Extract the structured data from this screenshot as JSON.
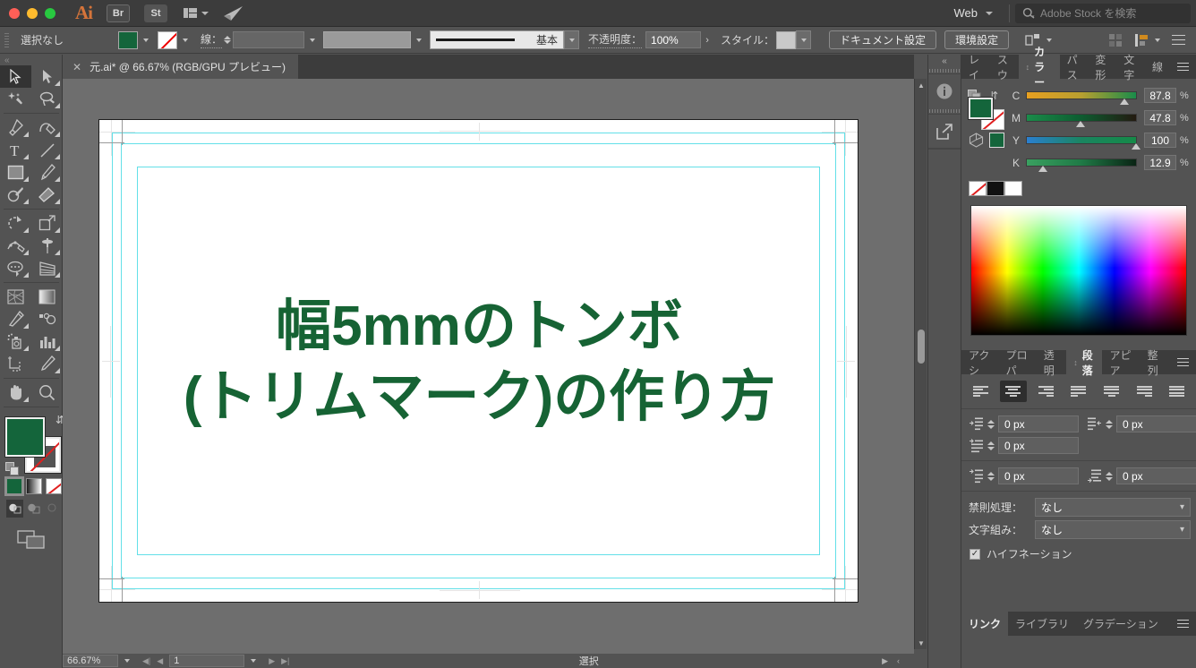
{
  "titlebar": {
    "app_icon": "ai-logo",
    "bridge_label": "Br",
    "stock_label": "St",
    "workspace_label": "Web",
    "search_placeholder": "Adobe Stock を検索",
    "search_icon": "search-icon",
    "share_icon": "share-paper-plane-icon",
    "arrange_icon": "arrange-documents-icon"
  },
  "controlbar": {
    "selection_status": "選択なし",
    "fill_swatch_color": "#14653b",
    "stroke_swatch": "none",
    "stroke_label": "線：",
    "stroke_weight": "",
    "stroke_variable_width": "",
    "stroke_profile_label": "基本",
    "opacity_label": "不透明度：",
    "opacity_value": "100%",
    "style_label": "スタイル：",
    "document_setup_button": "ドキュメント設定",
    "preferences_button": "環境設定",
    "align_icon": "align-to-selection-icon",
    "transform_icon": "transform-grid-icon",
    "distribute_icon": "distribute-icon",
    "panel_menu_icon": "panel-menu-icon"
  },
  "tabbar": {
    "close_icon": "close-icon",
    "document_title": "元.ai* @ 66.67% (RGB/GPU プレビュー)"
  },
  "toolbar": {
    "tools": [
      {
        "name": "selection-tool",
        "glyph": "selection",
        "selected": true
      },
      {
        "name": "direct-selection-tool",
        "glyph": "direct-selection",
        "selected": false
      },
      {
        "name": "magic-wand-tool",
        "glyph": "magic-wand",
        "selected": false
      },
      {
        "name": "lasso-tool",
        "glyph": "lasso",
        "selected": false
      },
      {
        "name": "pen-tool",
        "glyph": "pen",
        "selected": false
      },
      {
        "name": "curvature-tool",
        "glyph": "curvature",
        "selected": false
      },
      {
        "name": "type-tool",
        "glyph": "type",
        "selected": false
      },
      {
        "name": "line-segment-tool",
        "glyph": "line",
        "selected": false
      },
      {
        "name": "rectangle-tool",
        "glyph": "rectangle",
        "selected": false
      },
      {
        "name": "paintbrush-tool",
        "glyph": "paintbrush",
        "selected": false
      },
      {
        "name": "shaper-tool",
        "glyph": "shaper",
        "selected": false
      },
      {
        "name": "eraser-tool",
        "glyph": "eraser",
        "selected": false
      },
      {
        "name": "rotate-tool",
        "glyph": "rotate",
        "selected": false
      },
      {
        "name": "scale-tool",
        "glyph": "scale",
        "selected": false
      },
      {
        "name": "width-tool",
        "glyph": "width",
        "selected": false
      },
      {
        "name": "free-transform-tool",
        "glyph": "pushpin",
        "selected": false
      },
      {
        "name": "shape-builder-tool",
        "glyph": "shape-builder",
        "selected": false
      },
      {
        "name": "perspective-grid-tool",
        "glyph": "perspective-grid",
        "selected": false
      },
      {
        "name": "mesh-tool",
        "glyph": "mesh",
        "selected": false
      },
      {
        "name": "gradient-tool",
        "glyph": "gradient",
        "selected": false
      },
      {
        "name": "eyedropper-tool",
        "glyph": "eyedropper",
        "selected": false
      },
      {
        "name": "blend-tool",
        "glyph": "blend",
        "selected": false
      },
      {
        "name": "symbol-sprayer-tool",
        "glyph": "symbol-sprayer",
        "selected": false
      },
      {
        "name": "column-graph-tool",
        "glyph": "bar-chart",
        "selected": false
      },
      {
        "name": "artboard-tool",
        "glyph": "artboard",
        "selected": false
      },
      {
        "name": "slice-tool",
        "glyph": "slice-knife",
        "selected": false
      },
      {
        "name": "hand-tool",
        "glyph": "hand",
        "selected": false
      },
      {
        "name": "zoom-tool",
        "glyph": "magnifier",
        "selected": false
      }
    ],
    "fill_color": "#14653b",
    "stroke_color": "none",
    "fill_modes": [
      {
        "name": "color-fill-mode",
        "selected": true
      },
      {
        "name": "gradient-fill-mode",
        "selected": false
      },
      {
        "name": "none-fill-mode",
        "selected": false
      }
    ],
    "draw_modes": [
      {
        "name": "draw-normal-mode",
        "selected": true
      },
      {
        "name": "draw-behind-mode",
        "selected": false
      },
      {
        "name": "draw-inside-mode",
        "selected": false
      }
    ],
    "screen_mode": "change-screen-mode"
  },
  "dockstrip": {
    "collapse_icon": "collapse-panels-icon",
    "items": [
      {
        "name": "properties-info-icon"
      },
      {
        "name": "export-icon"
      }
    ]
  },
  "color_panel": {
    "tabs": [
      {
        "label": "レイ",
        "name": "tab-layers",
        "active": false
      },
      {
        "label": "スウ",
        "name": "tab-swatches",
        "active": false
      },
      {
        "label": "カラー",
        "name": "tab-color",
        "active": true
      },
      {
        "label": "パス",
        "name": "tab-pathfinder",
        "active": false
      },
      {
        "label": "変形",
        "name": "tab-transform",
        "active": false
      },
      {
        "label": "文字",
        "name": "tab-character",
        "active": false
      },
      {
        "label": "線",
        "name": "tab-stroke",
        "active": false
      }
    ],
    "mode": "CMYK",
    "channels": [
      {
        "letter": "C",
        "value": "87.8",
        "unit": "%",
        "knob_pct": 87.8
      },
      {
        "letter": "M",
        "value": "47.8",
        "unit": "%",
        "knob_pct": 47.8
      },
      {
        "letter": "Y",
        "value": "100",
        "unit": "%",
        "knob_pct": 100
      },
      {
        "letter": "K",
        "value": "12.9",
        "unit": "%",
        "knob_pct": 12.9
      }
    ],
    "fill_color": "#14653b",
    "stroke_color": "none",
    "quick_swatches": [
      "none",
      "#111111",
      "#ffffff"
    ],
    "spectrum_name": "color-spectrum-picker"
  },
  "paragraph_panel": {
    "tabs": [
      {
        "label": "アクシ",
        "name": "tab-actions",
        "active": false
      },
      {
        "label": "プロパ",
        "name": "tab-properties",
        "active": false
      },
      {
        "label": "透明",
        "name": "tab-transparency",
        "active": false
      },
      {
        "label": "段落",
        "name": "tab-paragraph",
        "active": true
      },
      {
        "label": "アピア",
        "name": "tab-appearance",
        "active": false
      },
      {
        "label": "整列",
        "name": "tab-align",
        "active": false
      }
    ],
    "alignments": [
      {
        "name": "align-left",
        "selected": false
      },
      {
        "name": "align-center",
        "selected": true
      },
      {
        "name": "align-right",
        "selected": false
      },
      {
        "name": "justify-last-left",
        "selected": false
      },
      {
        "name": "justify-last-center",
        "selected": false
      },
      {
        "name": "justify-last-right",
        "selected": false
      },
      {
        "name": "justify-all",
        "selected": false
      }
    ],
    "indent_left": "0 px",
    "indent_right": "0 px",
    "indent_first_line": "0 px",
    "space_before": "0 px",
    "space_after": "0 px",
    "kinsoku_label": "禁則処理：",
    "kinsoku_value": "なし",
    "mojikumi_label": "文字組み：",
    "mojikumi_value": "なし",
    "hyphenation_label": "ハイフネーション",
    "hyphenation_checked": true
  },
  "bottom_panel": {
    "tabs": [
      {
        "label": "リンク",
        "name": "tab-links",
        "active": true
      },
      {
        "label": "ライブラリ",
        "name": "tab-libraries",
        "active": false
      },
      {
        "label": "グラデーション",
        "name": "tab-gradient",
        "active": false
      }
    ]
  },
  "canvas": {
    "artboard_bg": "#ffffff",
    "guide_color": "#63e0e8",
    "text_color": "#166334",
    "text_lines": [
      "幅5mmのトンボ",
      "(トリムマーク)の作り方"
    ]
  },
  "statusbar": {
    "zoom_level": "66.67%",
    "page_number": "1",
    "tool_status": "選択",
    "first_icon": "first-artboard-icon",
    "prev_icon": "prev-artboard-icon",
    "next_icon": "next-artboard-icon",
    "last_icon": "last-artboard-icon"
  }
}
